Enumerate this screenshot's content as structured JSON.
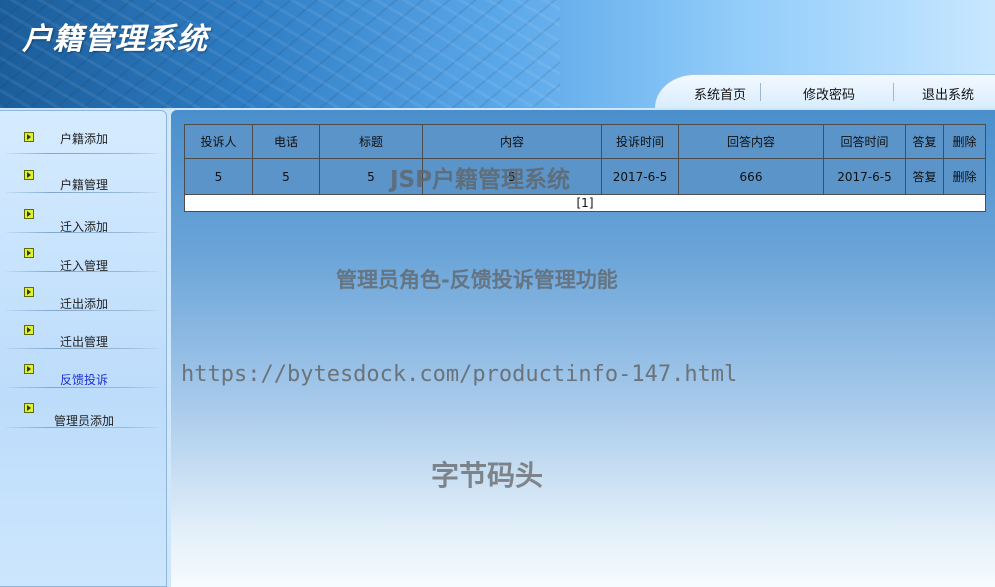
{
  "header": {
    "title": "户籍管理系统",
    "nav": [
      "系统首页",
      "修改密码",
      "退出系统"
    ]
  },
  "sidebar": {
    "items": [
      {
        "label": "户籍添加"
      },
      {
        "label": "户籍管理"
      },
      {
        "label": "迁入添加"
      },
      {
        "label": "迁入管理"
      },
      {
        "label": "迁出添加"
      },
      {
        "label": "迁出管理"
      },
      {
        "label": "反馈投诉",
        "active": true
      },
      {
        "label": "管理员添加"
      }
    ]
  },
  "table": {
    "columns": [
      "投诉人",
      "电话",
      "标题",
      "内容",
      "投诉时间",
      "回答内容",
      "回答时间",
      "答复",
      "删除"
    ],
    "rows": [
      [
        "5",
        "5",
        "5",
        "5",
        "2017-6-5",
        "666",
        "2017-6-5",
        "答复",
        "删除"
      ]
    ],
    "pager": "[1]"
  },
  "watermarks": {
    "system": "JSP户籍管理系统",
    "role": "管理员角色-反馈投诉管理功能",
    "url": "https://bytesdock.com/productinfo-147.html",
    "brand": "字节码头"
  },
  "colors": {
    "active_link": "#1d2fd6",
    "table_bg": "#5b94c8"
  }
}
